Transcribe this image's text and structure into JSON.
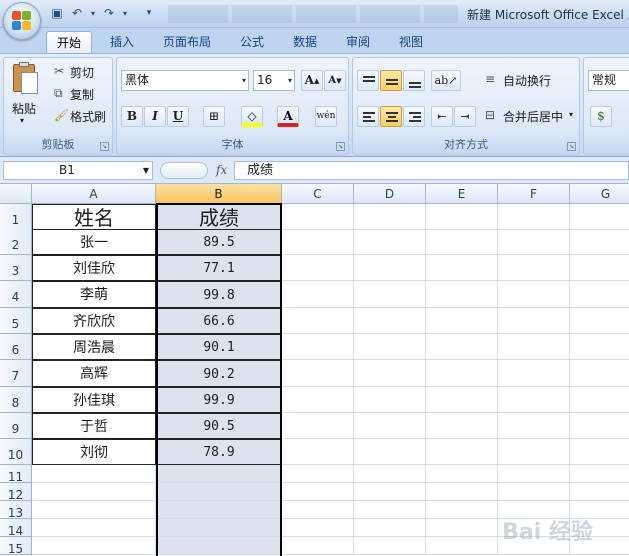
{
  "window": {
    "title": "新建 Microsoft Office Excel 工"
  },
  "ribbon": {
    "tabs": [
      "开始",
      "插入",
      "页面布局",
      "公式",
      "数据",
      "审阅",
      "视图"
    ],
    "clipboard": {
      "label": "剪贴板",
      "paste": "粘贴",
      "cut": "剪切",
      "copy": "复制",
      "format_painter": "格式刷"
    },
    "font": {
      "label": "字体",
      "name": "黑体",
      "size": "16",
      "grow": "A",
      "shrink": "A",
      "bold": "B",
      "italic": "I",
      "underline": "U",
      "wen": "wén"
    },
    "alignment": {
      "label": "对齐方式",
      "wrap": "自动换行",
      "merge": "合并后居中"
    },
    "number": {
      "format": "常规"
    }
  },
  "formula_bar": {
    "name_box": "B1",
    "fx": "fx",
    "content": "成绩"
  },
  "grid": {
    "columns": [
      "A",
      "B",
      "C",
      "D",
      "E",
      "F",
      "G"
    ],
    "selected_column": "B",
    "rows": [
      "1",
      "2",
      "3",
      "4",
      "5",
      "6",
      "7",
      "8",
      "9",
      "10",
      "11",
      "12",
      "13",
      "14",
      "15"
    ],
    "header": {
      "name": "姓名",
      "score": "成绩"
    },
    "records": [
      {
        "name": "张一",
        "score": "89.5"
      },
      {
        "name": "刘佳欣",
        "score": "77.1"
      },
      {
        "name": "李萌",
        "score": "99.8"
      },
      {
        "name": "齐欣欣",
        "score": "66.6"
      },
      {
        "name": "周浩晨",
        "score": "90.1"
      },
      {
        "name": "高辉",
        "score": "90.2"
      },
      {
        "name": "孙佳琪",
        "score": "99.9"
      },
      {
        "name": "于哲",
        "score": "90.5"
      },
      {
        "name": "刘彻",
        "score": "78.9"
      }
    ]
  },
  "watermark": "Bai 经验"
}
